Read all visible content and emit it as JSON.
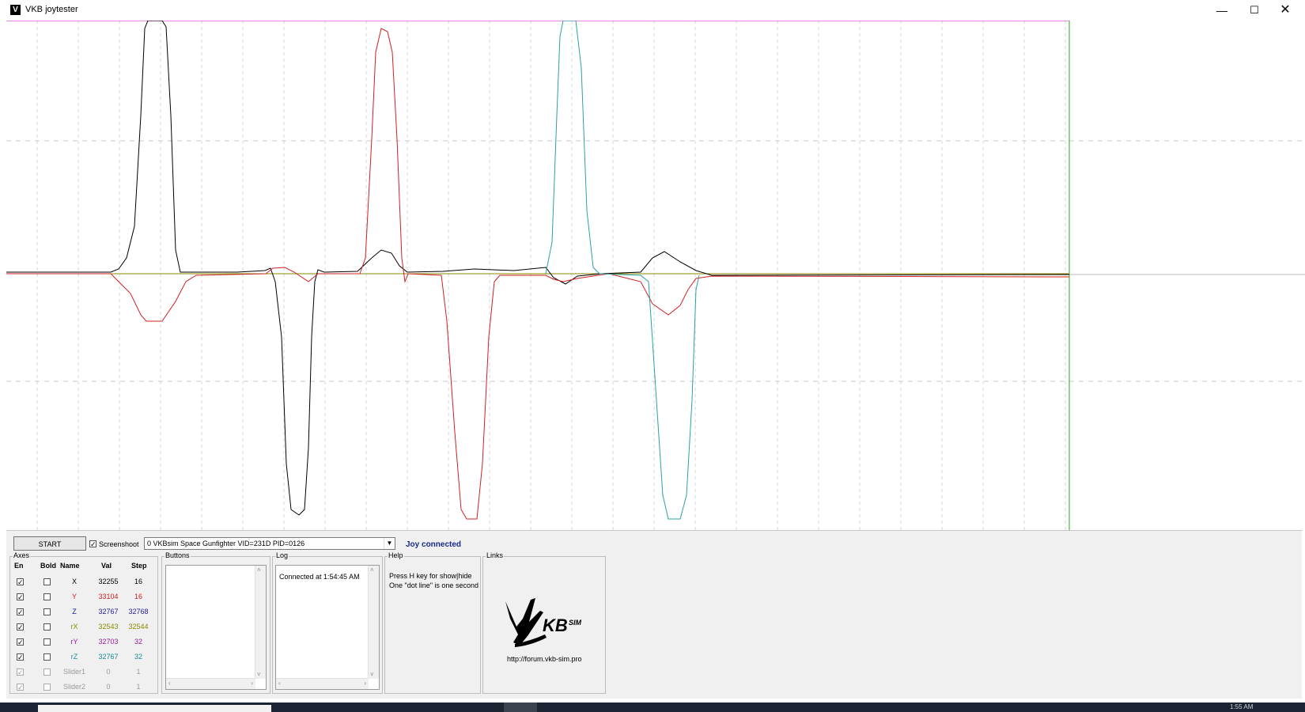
{
  "window": {
    "app_icon": "vkb-logo-icon",
    "title": "VKB joytester",
    "controls": [
      "minimize-icon",
      "maximize-icon",
      "close-icon"
    ],
    "min_glyph": "—",
    "max_glyph": "☐",
    "close_glyph": "✕"
  },
  "toolbar": {
    "start_label": "START",
    "screenshot_label": "Screenshoot",
    "screenshot_checked": true,
    "device_selected": "0  VKBsim Space Gunfighter  VID=231D PID=0126",
    "status": "Joy connected",
    "status_color": "#1a2a8c"
  },
  "axes": {
    "group_label": "Axes",
    "headers": {
      "en": "En",
      "bold": "Bold",
      "name": "Name",
      "val": "Val",
      "step": "Step"
    },
    "rows": [
      {
        "name": "X",
        "val": "32255",
        "step": "16",
        "enabled": true,
        "bold": false,
        "color": "#000000",
        "disabled": false
      },
      {
        "name": "Y",
        "val": "33104",
        "step": "16",
        "enabled": true,
        "bold": false,
        "color": "#d22020",
        "disabled": false
      },
      {
        "name": "Z",
        "val": "32767",
        "step": "32768",
        "enabled": true,
        "bold": false,
        "color": "#1c1c9a",
        "disabled": false
      },
      {
        "name": "rX",
        "val": "32543",
        "step": "32544",
        "enabled": true,
        "bold": false,
        "color": "#8a8a00",
        "disabled": false
      },
      {
        "name": "rY",
        "val": "32703",
        "step": "32",
        "enabled": true,
        "bold": false,
        "color": "#9a1a9a",
        "disabled": false
      },
      {
        "name": "rZ",
        "val": "32767",
        "step": "32",
        "enabled": true,
        "bold": false,
        "color": "#1a8a9a",
        "disabled": false
      },
      {
        "name": "Slider1",
        "val": "0",
        "step": "1",
        "enabled": true,
        "bold": false,
        "color": "#9a9a9a",
        "disabled": true
      },
      {
        "name": "Slider2",
        "val": "0",
        "step": "1",
        "enabled": true,
        "bold": false,
        "color": "#9a9a9a",
        "disabled": true
      }
    ]
  },
  "buttons_group": {
    "label": "Buttons"
  },
  "log_group": {
    "label": "Log",
    "lines": [
      "Connected at 1:54:45 AM"
    ]
  },
  "help_group": {
    "label": "Help",
    "line1": "Press H key for show|hide",
    "line2": "One \"dot line\" is one second"
  },
  "links_group": {
    "label": "Links",
    "logo": "vkbsim-logo",
    "logo_text": "KB",
    "logo_sup": "SIM",
    "url": "http://forum.vkb-sim.pro"
  },
  "plot_colors": {
    "X": "#000000",
    "Y": "#cc2222",
    "Z": "#1c1c9a",
    "rX": "#8a8a00",
    "rY": "#a020a0",
    "rZ": "#2aa0a8",
    "top_line": "#e060e0",
    "cursor_line": "#22aa22",
    "grid": "#cfcfcf"
  },
  "taskbar": {
    "clock": "1:55 AM"
  }
}
